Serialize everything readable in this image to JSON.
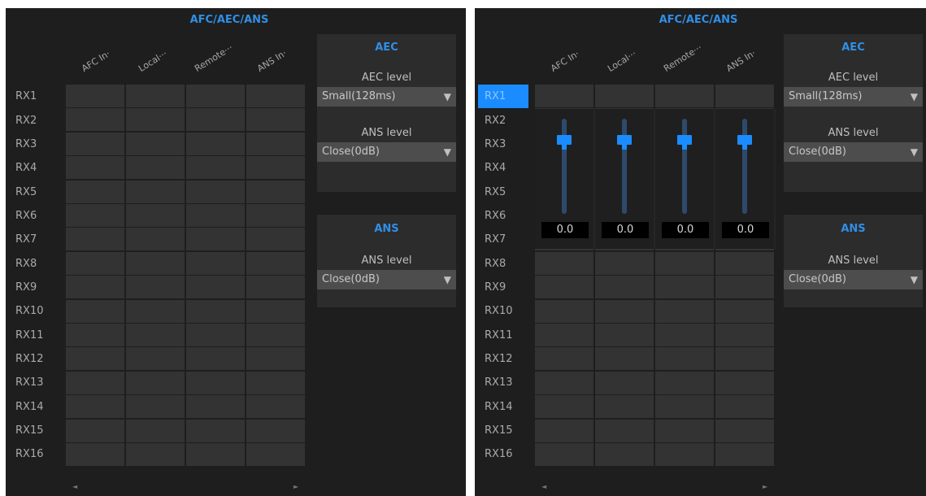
{
  "title": "AFC/AEC/ANS",
  "columns": [
    "AFC In·",
    "Local···",
    "Remote···",
    "ANS In·"
  ],
  "rows": [
    "RX1",
    "RX2",
    "RX3",
    "RX4",
    "RX5",
    "RX6",
    "RX7",
    "RX8",
    "RX9",
    "RX10",
    "RX11",
    "RX12",
    "RX13",
    "RX14",
    "RX15",
    "RX16"
  ],
  "selected_row": "RX1",
  "aec_group": {
    "title": "AEC",
    "aec_label": "AEC level",
    "aec_value": "Small(128ms)",
    "ans_label": "ANS level",
    "ans_value": "Close(0dB)"
  },
  "ans_group": {
    "title": "ANS",
    "ans_label": "ANS level",
    "ans_value": "Close(0dB)"
  },
  "faders": [
    {
      "value": "0.0"
    },
    {
      "value": "0.0"
    },
    {
      "value": "0.0"
    },
    {
      "value": "0.0"
    }
  ],
  "scroll": {
    "left": "◄",
    "right": "►"
  },
  "dropdown_arrow": "▼",
  "colors": {
    "accent": "#1a8cff",
    "background": "#1e1e1e",
    "cell": "#333333",
    "control": "#4d4d4d"
  }
}
